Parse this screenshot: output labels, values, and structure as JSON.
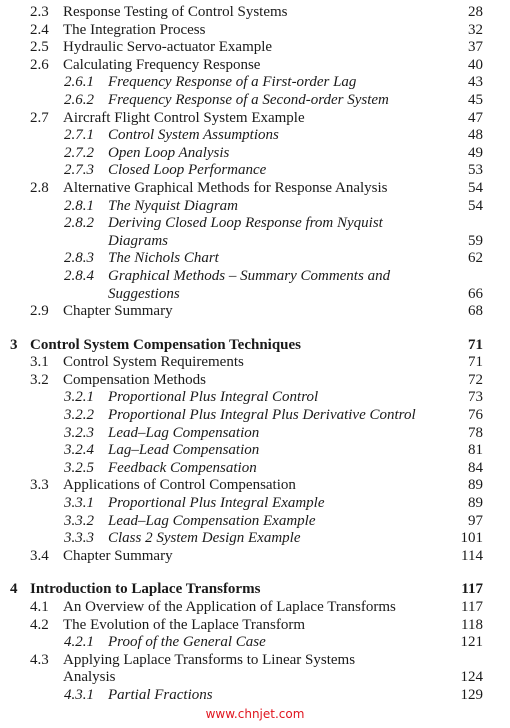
{
  "toc": {
    "entries": [
      {
        "level": "section",
        "num": "2.3",
        "title": "Response Testing of Control Systems",
        "page": "28"
      },
      {
        "level": "section",
        "num": "2.4",
        "title": "The Integration Process",
        "page": "32"
      },
      {
        "level": "section",
        "num": "2.5",
        "title": "Hydraulic Servo-actuator Example",
        "page": "37"
      },
      {
        "level": "section",
        "num": "2.6",
        "title": "Calculating Frequency Response",
        "page": "40"
      },
      {
        "level": "sub",
        "num": "2.6.1",
        "title": "Frequency Response of a First-order Lag",
        "page": "43"
      },
      {
        "level": "sub",
        "num": "2.6.2",
        "title": "Frequency Response of a Second-order System",
        "page": "45"
      },
      {
        "level": "section",
        "num": "2.7",
        "title": "Aircraft Flight Control System Example",
        "page": "47"
      },
      {
        "level": "sub",
        "num": "2.7.1",
        "title": "Control System Assumptions",
        "page": "48"
      },
      {
        "level": "sub",
        "num": "2.7.2",
        "title": "Open Loop Analysis",
        "page": "49"
      },
      {
        "level": "sub",
        "num": "2.7.3",
        "title": "Closed Loop Performance",
        "page": "53"
      },
      {
        "level": "section",
        "num": "2.8",
        "title": "Alternative Graphical Methods for Response Analysis",
        "page": "54"
      },
      {
        "level": "sub",
        "num": "2.8.1",
        "title": "The Nyquist Diagram",
        "page": "54"
      },
      {
        "level": "sub",
        "num": "2.8.2",
        "title": "Deriving Closed Loop Response from Nyquist",
        "title_cont": "Diagrams",
        "page": "59"
      },
      {
        "level": "sub",
        "num": "2.8.3",
        "title": "The Nichols Chart",
        "page": "62"
      },
      {
        "level": "sub",
        "num": "2.8.4",
        "title": "Graphical Methods – Summary Comments and",
        "title_cont": "Suggestions",
        "page": "66"
      },
      {
        "level": "section",
        "num": "2.9",
        "title": "Chapter Summary",
        "page": "68"
      },
      {
        "level": "gap"
      },
      {
        "level": "chapter",
        "num": "3",
        "title": "Control System Compensation Techniques",
        "page": "71"
      },
      {
        "level": "section",
        "num": "3.1",
        "title": "Control System Requirements",
        "page": "71"
      },
      {
        "level": "section",
        "num": "3.2",
        "title": "Compensation Methods",
        "page": "72"
      },
      {
        "level": "sub",
        "num": "3.2.1",
        "title": "Proportional Plus Integral Control",
        "page": "73"
      },
      {
        "level": "sub",
        "num": "3.2.2",
        "title": "Proportional Plus Integral Plus Derivative Control",
        "page": "76"
      },
      {
        "level": "sub",
        "num": "3.2.3",
        "title": "Lead–Lag Compensation",
        "page": "78"
      },
      {
        "level": "sub",
        "num": "3.2.4",
        "title": "Lag–Lead Compensation",
        "page": "81"
      },
      {
        "level": "sub",
        "num": "3.2.5",
        "title": "Feedback Compensation",
        "page": "84"
      },
      {
        "level": "section",
        "num": "3.3",
        "title": "Applications of Control Compensation",
        "page": "89"
      },
      {
        "level": "sub",
        "num": "3.3.1",
        "title": "Proportional Plus Integral Example",
        "page": "89"
      },
      {
        "level": "sub",
        "num": "3.3.2",
        "title": "Lead–Lag Compensation Example",
        "page": "97"
      },
      {
        "level": "sub",
        "num": "3.3.3",
        "title": "Class 2 System Design Example",
        "page": "101"
      },
      {
        "level": "section",
        "num": "3.4",
        "title": "Chapter Summary",
        "page": "114"
      },
      {
        "level": "gap"
      },
      {
        "level": "chapter",
        "num": "4",
        "title": "Introduction to Laplace Transforms",
        "page": "117"
      },
      {
        "level": "section",
        "num": "4.1",
        "title": "An Overview of the Application of Laplace Transforms",
        "page": "117"
      },
      {
        "level": "section",
        "num": "4.2",
        "title": "The Evolution of the Laplace Transform",
        "page": "118"
      },
      {
        "level": "sub",
        "num": "4.2.1",
        "title": "Proof of the General Case",
        "page": "121"
      },
      {
        "level": "section",
        "num": "4.3",
        "title": "Applying Laplace Transforms to Linear Systems",
        "title_cont": "Analysis",
        "page": "124"
      },
      {
        "level": "sub",
        "num": "4.3.1",
        "title": "Partial Fractions",
        "page": "129"
      }
    ]
  },
  "watermark": {
    "text": "www.chnjet.com",
    "color": "#e0141e"
  }
}
